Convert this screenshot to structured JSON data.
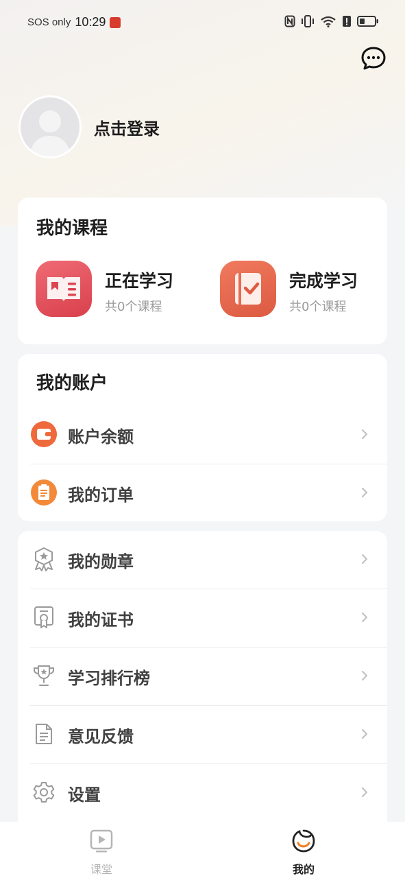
{
  "status_bar": {
    "carrier": "SOS only",
    "time": "10:29",
    "icons": [
      "app-notification-icon",
      "nfc-icon",
      "vibrate-icon",
      "wifi-icon",
      "alert-icon",
      "battery-icon"
    ]
  },
  "header": {
    "message_icon": "chat-bubble-icon"
  },
  "profile": {
    "login_text": "点击登录"
  },
  "my_courses": {
    "title": "我的课程",
    "items": [
      {
        "name": "正在学习",
        "count": "共0个课程",
        "icon": "open-book-icon",
        "color": "#e2505c"
      },
      {
        "name": "完成学习",
        "count": "共0个课程",
        "icon": "checked-notebook-icon",
        "color": "#e5674d"
      }
    ]
  },
  "my_account": {
    "title": "我的账户",
    "items": [
      {
        "label": "账户余额",
        "icon": "wallet-icon",
        "color": "#ee6a3c"
      },
      {
        "label": "我的订单",
        "icon": "order-icon",
        "color": "#f28a3a"
      }
    ]
  },
  "menu": {
    "items": [
      {
        "label": "我的勋章",
        "icon": "medal-icon"
      },
      {
        "label": "我的证书",
        "icon": "certificate-icon"
      },
      {
        "label": "学习排行榜",
        "icon": "trophy-icon"
      },
      {
        "label": "意见反馈",
        "icon": "feedback-document-icon"
      },
      {
        "label": "设置",
        "icon": "gear-icon"
      }
    ]
  },
  "bottom_nav": {
    "items": [
      {
        "label": "课堂",
        "icon": "play-screen-icon",
        "active": false
      },
      {
        "label": "我的",
        "icon": "mine-face-icon",
        "active": true
      }
    ]
  }
}
